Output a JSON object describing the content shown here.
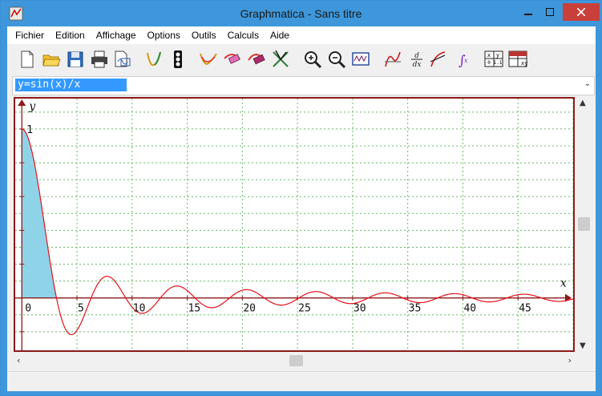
{
  "window": {
    "title": "Graphmatica - Sans titre"
  },
  "menu": [
    "Fichier",
    "Edition",
    "Affichage",
    "Options",
    "Outils",
    "Calculs",
    "Aide"
  ],
  "equation": {
    "value": "y=sin(x)/x"
  },
  "graph": {
    "x_axis_label": "x",
    "y_axis_label": "y",
    "x_ticks": [
      "0",
      "5",
      "10",
      "15",
      "20",
      "25",
      "30",
      "35",
      "40",
      "45"
    ],
    "y_ticks": [
      "1"
    ]
  },
  "colors": {
    "axis": "#8b1a1a",
    "curve": "#e8101a",
    "fill": "#8fd3e8",
    "grid": "#69b86a",
    "titlebar": "#3e97da"
  },
  "chart_data": {
    "type": "line",
    "function": "y=sin(x)/x",
    "xlabel": "x",
    "ylabel": "y",
    "xlim": [
      -0.6,
      50.0
    ],
    "ylim": [
      -0.31,
      1.18
    ],
    "x_ticks": [
      0,
      5,
      10,
      15,
      20,
      25,
      30,
      35,
      40,
      45
    ],
    "y_ticks": [
      1
    ],
    "shaded_region_x": [
      0,
      3.14159
    ],
    "grid": true
  }
}
